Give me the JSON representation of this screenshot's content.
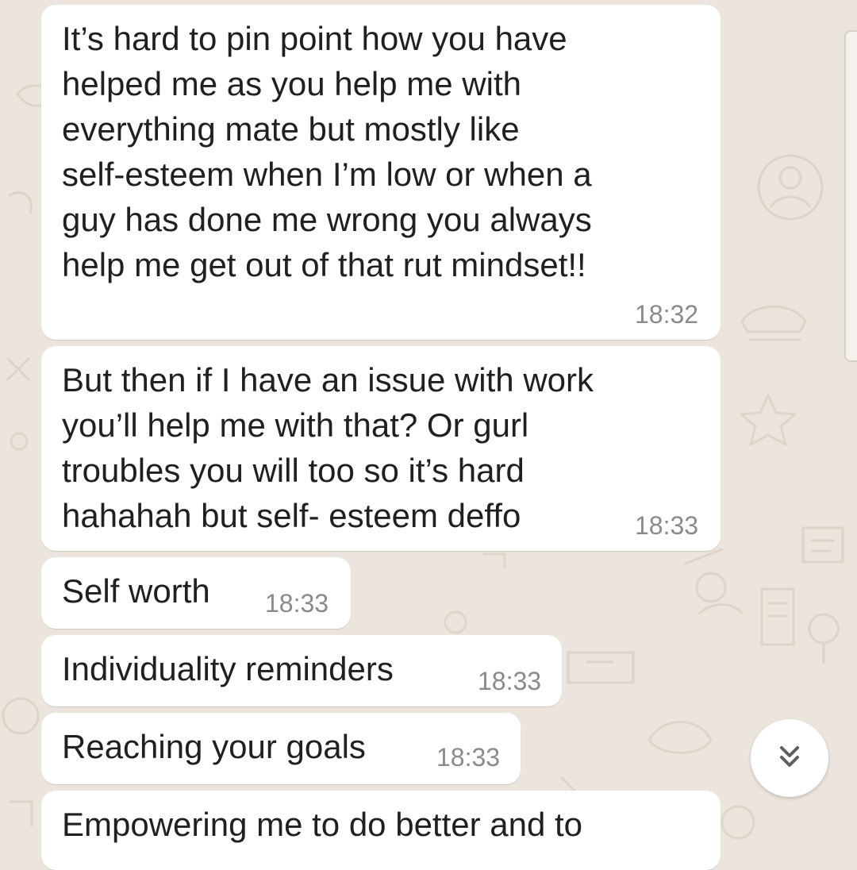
{
  "colors": {
    "wallpaper": "#ECE5DD",
    "bubble": "#FFFFFF",
    "text": "#202020",
    "time": "#8A8A8A"
  },
  "messages": [
    {
      "text": "It’s hard to pin point how you have\nhelped me as you help me with\neverything mate but mostly like\nself-esteem when I’m low or when a\nguy has done me wrong you always\nhelp me get out of that rut mindset!!",
      "time": "18:32"
    },
    {
      "text": "But then if I have an issue with work\nyou’ll help me with that? Or gurl\ntroubles you will too so it’s hard\nhahahah but self- esteem deffo",
      "time": "18:33"
    },
    {
      "text": "Self worth",
      "time": "18:33"
    },
    {
      "text": "Individuality reminders",
      "time": "18:33"
    },
    {
      "text": "Reaching your goals",
      "time": "18:33"
    },
    {
      "text": "Empowering me to do better and to"
    }
  ],
  "scroll_button": {
    "icon": "double-chevron-down-icon"
  }
}
